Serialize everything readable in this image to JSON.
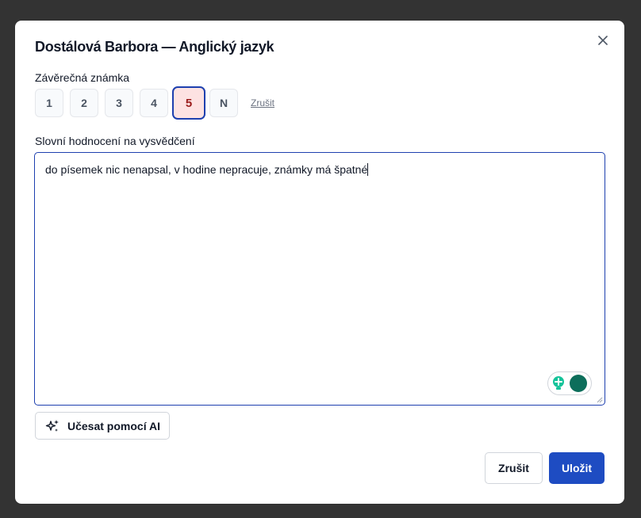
{
  "dialog": {
    "title": "Dostálová Barbora — Anglický jazyk",
    "close_icon": "close-icon"
  },
  "final_grade": {
    "label": "Závěrečná známka",
    "options": [
      "1",
      "2",
      "3",
      "4",
      "5",
      "N"
    ],
    "selected": "5",
    "clear_label": "Zrušit"
  },
  "verbal_assessment": {
    "label": "Slovní hodnocení na vysvědčení",
    "value": "do písemek nic nenapsal, v hodine nepracuje, známky má špatné"
  },
  "ai_button": {
    "label": "Učesat pomocí AI",
    "icon": "sparkles-icon"
  },
  "footer": {
    "cancel_label": "Zrušit",
    "save_label": "Uložit"
  },
  "colors": {
    "overlay": "#333333",
    "accent": "#1e4cc2",
    "selected_grade_bg": "#fde2e2",
    "selected_grade_text": "#9b1c1c"
  }
}
